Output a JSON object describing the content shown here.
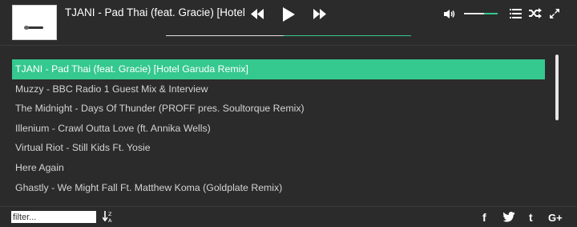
{
  "now_playing": {
    "title": "TJANI - Pad Thai (feat. Gracie) [Hotel Garuda Remix]",
    "progress": 0.48
  },
  "volume": {
    "level": 0.6
  },
  "icons": {
    "prev": "rewind-icon",
    "play": "play-icon",
    "next": "fast-forward-icon",
    "volume": "volume-icon",
    "playlist": "list-icon",
    "shuffle": "shuffle-icon",
    "fullscreen": "expand-icon",
    "sort": "sort-alpha-icon",
    "facebook": "facebook-icon",
    "twitter": "twitter-icon",
    "tumblr": "tumblr-icon",
    "googleplus": "google-plus-icon"
  },
  "colors": {
    "accent": "#35c88f",
    "background": "#2b2b2b"
  },
  "playlist": {
    "tracks": [
      "TJANI - Pad Thai (feat. Gracie) [Hotel Garuda Remix]",
      "Muzzy - BBC Radio 1 Guest Mix & Interview",
      "The Midnight - Days Of Thunder (PROFF pres. Soultorque Remix)",
      "Illenium - Crawl Outta Love (ft. Annika Wells)",
      "Virtual Riot - Still Kids Ft. Yosie",
      "Here Again",
      "Ghastly - We Might Fall Ft. Matthew Koma (Goldplate Remix)"
    ],
    "active_index": 0
  },
  "footer": {
    "filter_placeholder": "filter...",
    "social": {
      "facebook": "f",
      "tumblr": "t",
      "googleplus": "G+"
    }
  }
}
